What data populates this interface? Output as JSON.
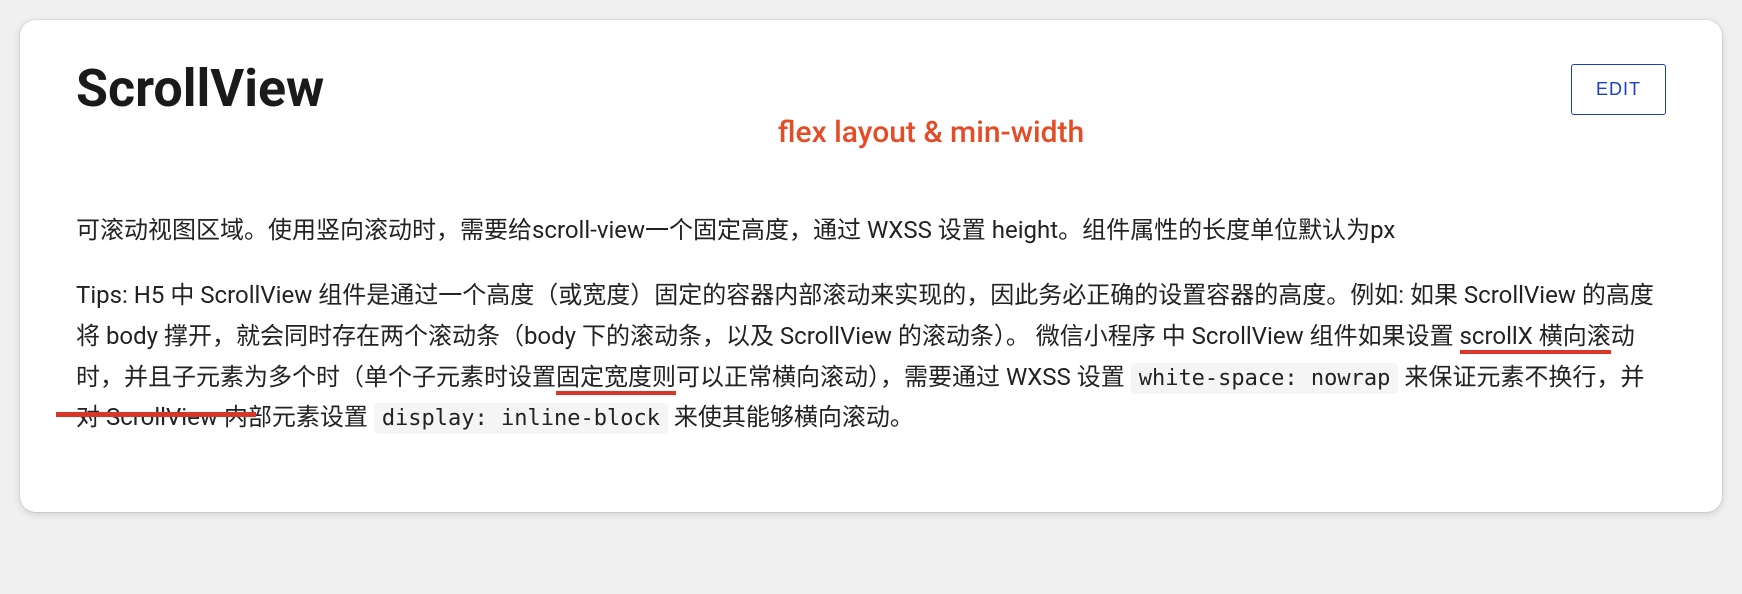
{
  "header": {
    "title": "ScrollView",
    "edit_label": "EDIT"
  },
  "annotation": {
    "red_text": "flex layout & min-width"
  },
  "paragraphs": {
    "p1": "可滚动视图区域。使用竖向滚动时，需要给scroll-view一个固定高度，通过 WXSS 设置 height。组件属性的长度单位默认为px",
    "p2_part1": "Tips: H5 中 ScrollView 组件是通过一个高度（或宽度）固定的容器内部滚动来实现的，因此务必正确的设置容器的高度。例如: 如果 ScrollView 的高度将 body 撑开，就会同时存在两个滚动条（body 下的滚动条，以及 ScrollView 的滚动条）。 微信小程序 中 ScrollView 组件如果设置 ",
    "p2_underline1": "scrollX 横向滚",
    "p2_part2": "动时，并且子元素为多个时（单个子元素时设置",
    "p2_underline2": "固定宽度则",
    "p2_part3": "可以正常横向滚动），需要通过 WXSS 设置 ",
    "p2_code1": "white-space: nowrap",
    "p2_part4": " 来保证元素不换行，并对 ScrollView 内部元素设置 ",
    "p2_code2": "display: inline-block",
    "p2_part5": " 来使其能够横向滚动。"
  }
}
